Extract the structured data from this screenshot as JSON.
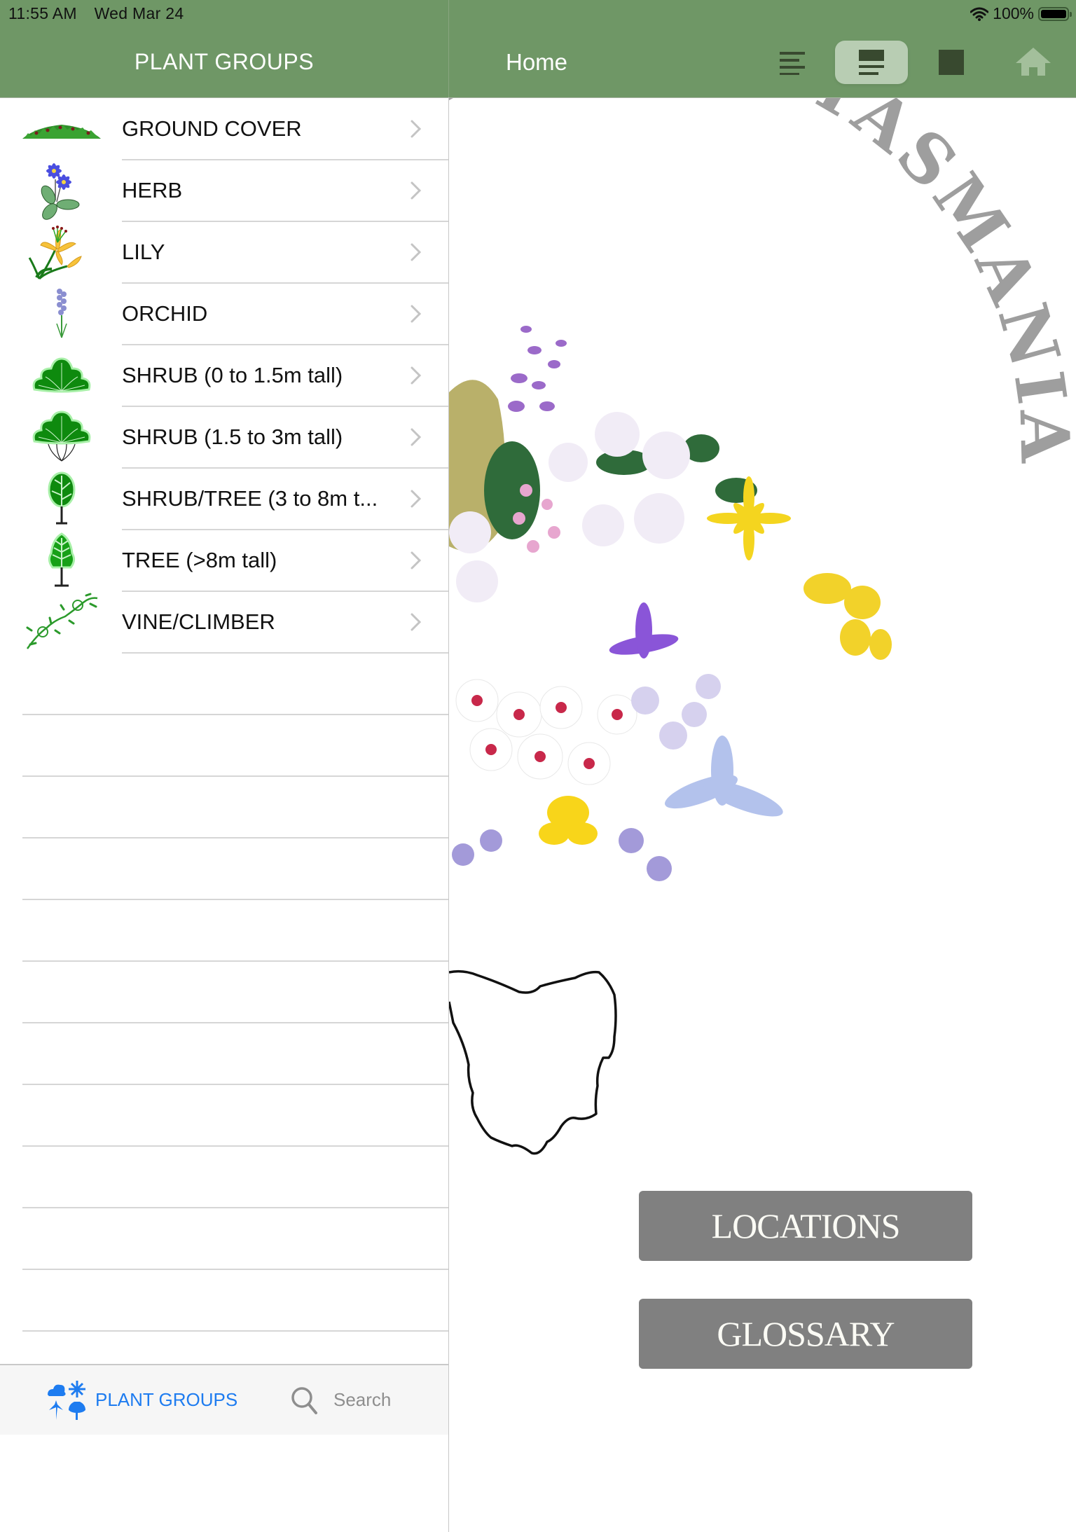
{
  "status_bar": {
    "time": "11:55 AM",
    "date": "Wed Mar 24",
    "battery": "100%",
    "wifi_icon": "wifi-icon",
    "battery_icon": "battery-full-icon"
  },
  "sidebar": {
    "title": "PLANT GROUPS",
    "items": [
      {
        "label": "GROUND COVER",
        "icon": "ground-cover-icon"
      },
      {
        "label": "HERB",
        "icon": "herb-icon"
      },
      {
        "label": "LILY",
        "icon": "lily-icon"
      },
      {
        "label": "ORCHID",
        "icon": "orchid-icon"
      },
      {
        "label": "SHRUB (0 to 1.5m tall)",
        "icon": "small-shrub-icon"
      },
      {
        "label": "SHRUB (1.5 to 3m tall)",
        "icon": "tall-shrub-icon"
      },
      {
        "label": "SHRUB/TREE (3 to 8m t...",
        "icon": "shrub-tree-icon"
      },
      {
        "label": "TREE (>8m tall)",
        "icon": "tree-icon"
      },
      {
        "label": "VINE/CLIMBER",
        "icon": "vine-icon"
      }
    ]
  },
  "tab_bar": {
    "tabs": [
      {
        "label": "PLANT GROUPS",
        "icon": "plant-groups-icon",
        "active": true
      },
      {
        "label": "Search",
        "icon": "search-icon",
        "active": false
      }
    ]
  },
  "detail": {
    "title": "Home",
    "toolbar": {
      "display_modes": [
        "sidebar-only",
        "side-by-side",
        "content-only"
      ],
      "selected_mode": "side-by-side",
      "home_icon": "home-icon"
    },
    "logo_text": "PLANTS OF TASMANIA",
    "logo_visible_text": "ANTS OF TASMANIA",
    "buttons": {
      "locations": "LOCATIONS",
      "glossary": "GLOSSARY"
    }
  },
  "colors": {
    "nav_green": "#6f9766",
    "toolbar_icon_dark": "#38492f",
    "segment_selected": "#b8cdb3",
    "home_icon": "#a3bf9b",
    "tab_active_blue": "#1e7cf0",
    "logo_gray": "#9e9e9e",
    "button_gray": "#808080"
  }
}
